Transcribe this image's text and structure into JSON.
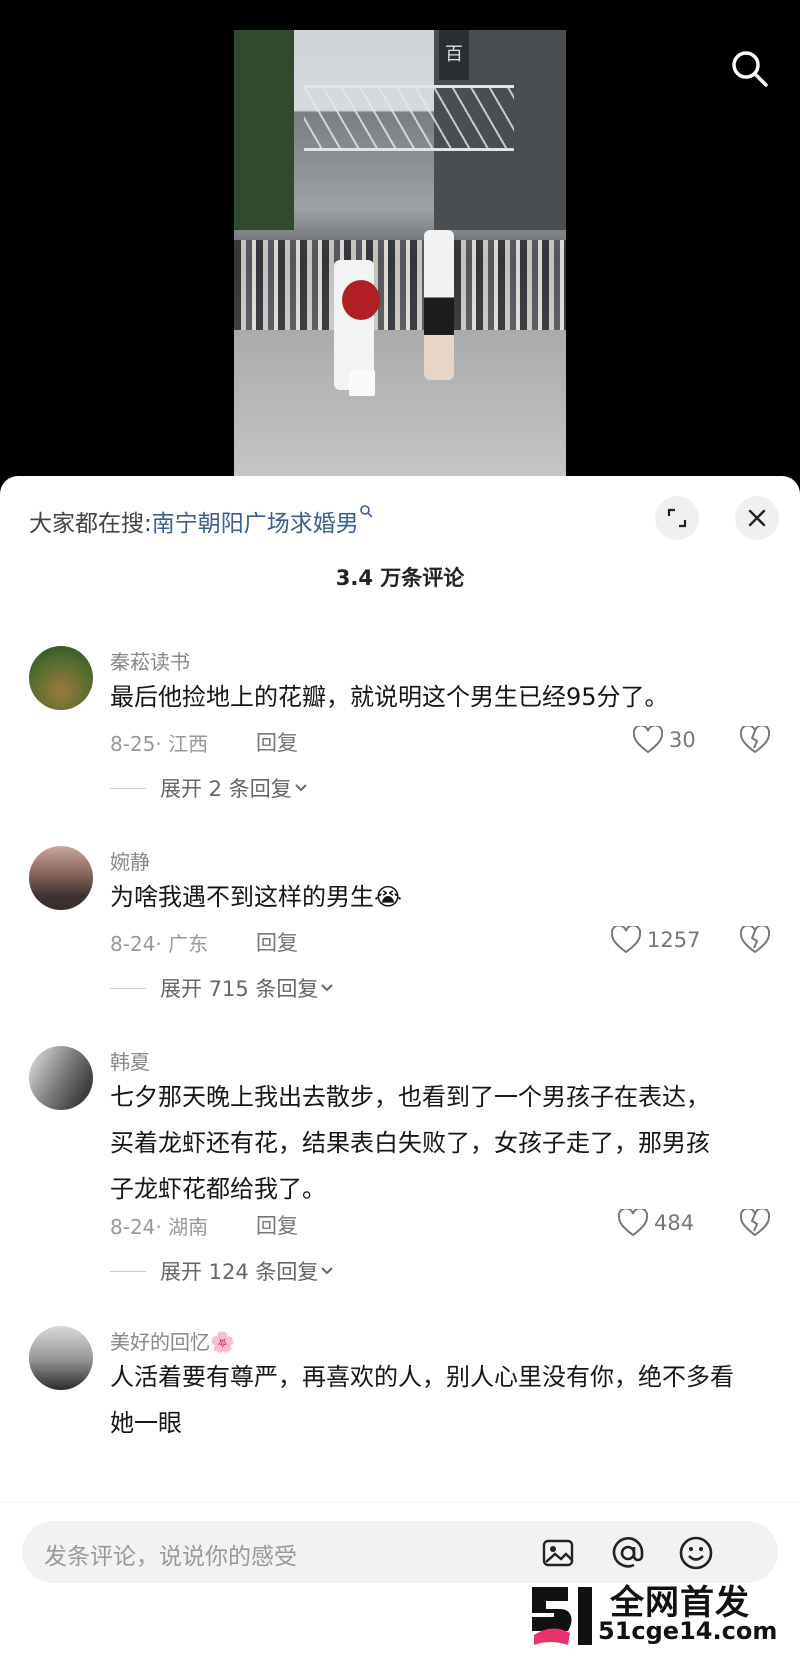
{
  "sheet": {
    "search_label": "大家都在搜:",
    "search_link": "南宁朝阳广场求婚男",
    "comment_count": "3.4 万条评论"
  },
  "comments": [
    {
      "username": "秦菘读书",
      "text": "最后他捡地上的花瓣，就说明这个男生已经95分了。",
      "meta": "8-25· 江西",
      "reply": "回复",
      "likes": "30",
      "expand": "展开 2 条回复"
    },
    {
      "username": "婉静",
      "text": "为啥我遇不到这样的男生",
      "emoji": "😭",
      "meta": "8-24· 广东",
      "reply": "回复",
      "likes": "1257",
      "expand": "展开 715 条回复"
    },
    {
      "username": "韩夏",
      "text": "七夕那天晚上我出去散步，也看到了一个男孩子在表达，买着龙虾还有花，结果表白失败了，女孩子走了，那男孩子龙虾花都给我了。",
      "meta": "8-24· 湖南",
      "reply": "回复",
      "likes": "484",
      "expand": "展开 124 条回复"
    },
    {
      "username": "美好的回忆",
      "username_emoji": "🌸",
      "text": "人活着要有尊严，再喜欢的人，别人心里没有你，绝不多看她一眼"
    }
  ],
  "input": {
    "placeholder": "发条评论，说说你的感受"
  },
  "video_sign": "百",
  "watermark": {
    "line1": "全网首发",
    "line2": "51cge14.com"
  },
  "colors": {
    "link": "#3a5f8f",
    "watermark_accent": "#e8336d"
  }
}
